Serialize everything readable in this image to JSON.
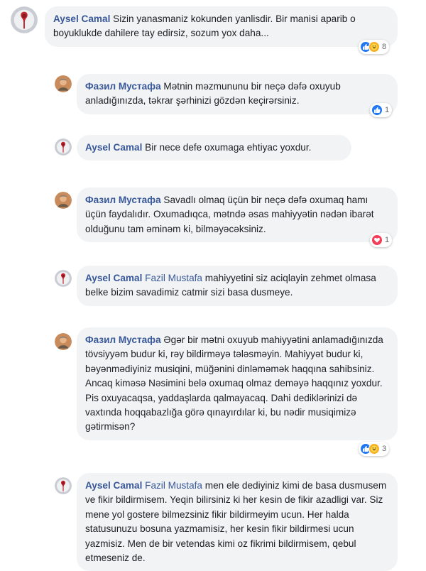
{
  "comments": [
    {
      "author": "Aysel Camal",
      "text": "Sizin yanasmaniz kokunden yanlisdir. Bir manisi aparib o boyuklukde dahilere tay edirsiz, sozum yox daha...",
      "reactions": {
        "icons": [
          "like-icon",
          "haha-icon"
        ],
        "count": "8"
      }
    },
    {
      "author": "Фазил Мустафа",
      "text": "Mətnin məzmununu bir neçə dəfə oxuyub anladığınızda, təkrar şərhinizi gözdən keçirərsiniz.",
      "reactions": {
        "icons": [
          "like-icon"
        ],
        "count": "1"
      }
    },
    {
      "author": "Aysel Camal",
      "text": "Bir nece defe oxumaga ehtiyac yoxdur."
    },
    {
      "author": "Фазил Мустафа",
      "text": "Savadlı olmaq üçün bir neçə dəfə oxumaq hamı üçün faydalıdır. Oxumadıqca, mətndə əsas mahiyyətin nədən ibarət olduğunu tam əminəm ki, bilməyəcəksiniz.",
      "reactions": {
        "icons": [
          "love-icon"
        ],
        "count": "1"
      }
    },
    {
      "author": "Aysel Camal",
      "mention": "Fazil Mustafa",
      "text": "mahiyyetini siz aciqlayin zehmet olmasa belke bizim savadimiz catmir sizi basa dusmeye."
    },
    {
      "author": "Фазил Мустафа",
      "text": "Əgər bir mətni oxuyub mahiyyətini anlamadığınızda tövsiyyəm budur ki, rəy bildirməyə tələsməyin. Mahiyyət budur ki, bəyənmədiyiniz musiqini, müğənini dinləməmək haqqına sahibsiniz. Ancaq kiməsə Nəsimini belə oxumaq olmaz deməyə haqqınız yoxdur. Pis oxuyacaqsa, yaddaşlarda qalmayacaq. Dahi dediklərinizi də vaxtında hoqqabazlığa görə qınayırdılar ki, bu nədir musiqimizə gətirmisən?",
      "reactions": {
        "icons": [
          "like-icon",
          "haha-icon"
        ],
        "count": "3"
      }
    },
    {
      "author": "Aysel Camal",
      "mention": "Fazil Mustafa",
      "text": "men ele dediyiniz kimi de basa dusmusem ve fikir bildirmisem. Yeqin bilirsiniz ki her kesin de fikir azadligi var. Siz mene yol gostere bilmezsiniz fikir bildirmeyim ucun. Her halda statusunuzu bosuna yazmamisiz, her kesin fikir bildirmesi ucun yazmisiz. Men de bir vetendas kimi oz fikrimi bildirmisem, qebul etmeseniz de."
    }
  ]
}
